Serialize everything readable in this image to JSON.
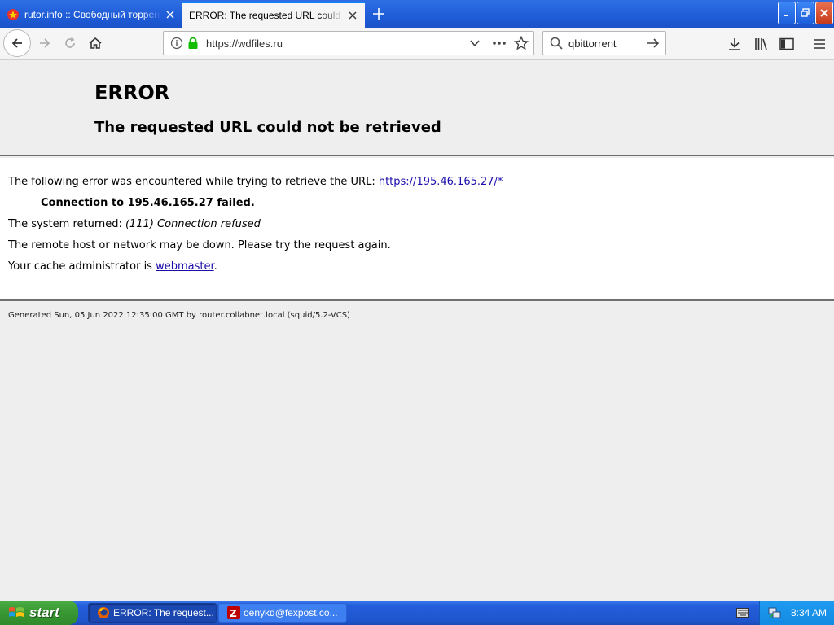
{
  "browser": {
    "tabs": [
      {
        "label": "rutor.info :: Свободный торрент",
        "active": false
      },
      {
        "label": "ERROR: The requested URL could not be retrieved",
        "active": true
      }
    ],
    "address": "https://wdfiles.ru",
    "search_query": "qbittorrent"
  },
  "page": {
    "title": "ERROR",
    "subtitle": "The requested URL could not be retrieved",
    "intro_text": "The following error was encountered while trying to retrieve the URL: ",
    "intro_link": "https://195.46.165.27/*",
    "connection_failed": "Connection to 195.46.165.27 failed.",
    "system_prefix": "The system returned: ",
    "system_value": "(111) Connection refused",
    "remote_text": "The remote host or network may be down. Please try the request again.",
    "admin_prefix": "Your cache administrator is ",
    "admin_link": "webmaster",
    "admin_suffix": ".",
    "footer": "Generated Sun, 05 Jun 2022 12:35:00 GMT by router.collabnet.local (squid/5.2-VCS)"
  },
  "taskbar": {
    "start_label": "start",
    "items": [
      {
        "label": "ERROR: The request...",
        "active": true,
        "icon": "firefox-icon"
      },
      {
        "label": "oenykd@fexpost.co...",
        "active": false,
        "icon": "filezilla-icon"
      }
    ],
    "clock": "8:34 AM"
  },
  "colors": {
    "accent": "#0a84ff",
    "link": "#1a0dab",
    "taskbar": "#245edb",
    "start": "#3a9a34"
  }
}
